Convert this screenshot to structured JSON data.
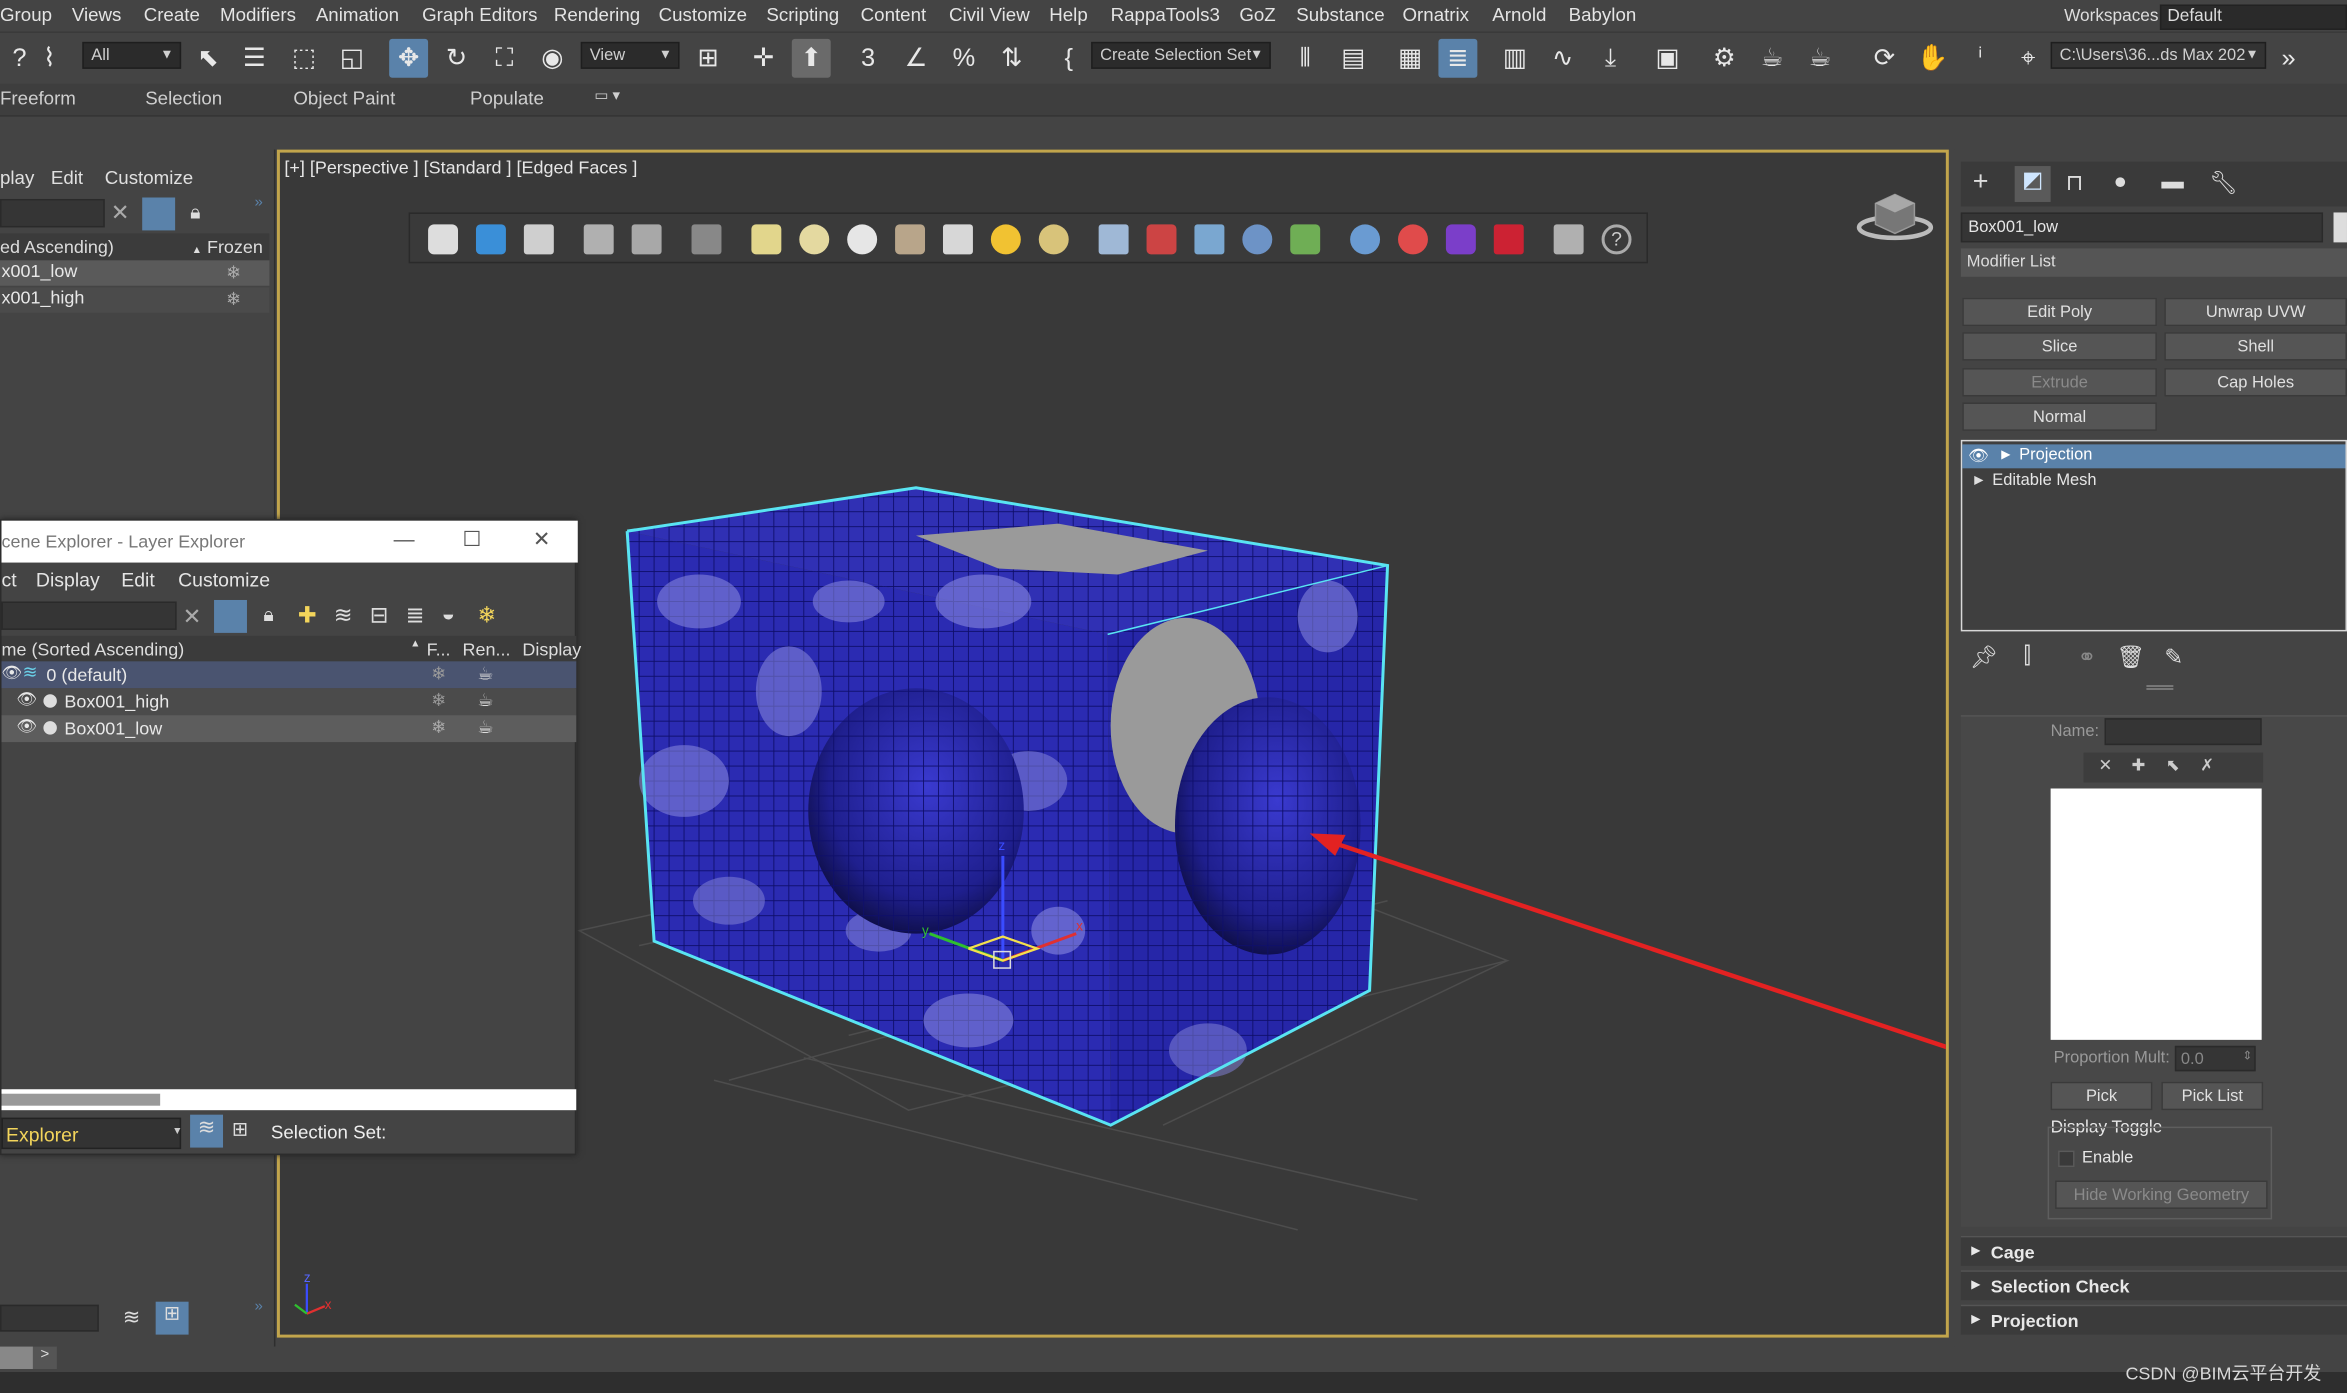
{
  "menubar": {
    "items": [
      "Group",
      "Views",
      "Create",
      "Modifiers",
      "Animation",
      "Graph Editors",
      "Rendering",
      "Customize",
      "Scripting",
      "Content",
      "Civil View",
      "Help",
      "RappaTools3",
      "GoZ",
      "Substance",
      "Ornatrix",
      "Arnold",
      "Babylon"
    ],
    "workspaces_label": "Workspaces:",
    "workspace_value": "Default"
  },
  "toolbar": {
    "filter_value": "All",
    "coord_value": "View",
    "selection_set_placeholder": "Create Selection Set",
    "project_path": "C:\\Users\\36...ds Max 202",
    "snap_label": "3"
  },
  "ribbon": {
    "tabs": [
      "Freeform",
      "Selection",
      "Object Paint",
      "Populate"
    ]
  },
  "left_explorer": {
    "menu": [
      "play",
      "Edit",
      "Customize"
    ],
    "column_name": "ed Ascending)",
    "column_frozen": "Frozen",
    "rows": [
      "x001_low",
      "x001_high"
    ]
  },
  "viewport": {
    "label": "[+] [Perspective ] [Standard ] [Edged Faces ]",
    "axis_labels": {
      "x": "x",
      "y": "y",
      "z": "z"
    }
  },
  "layer_explorer": {
    "title": "cene Explorer - Layer Explorer",
    "menu": [
      "ct",
      "Display",
      "Edit",
      "Customize"
    ],
    "columns": {
      "name": "me (Sorted Ascending)",
      "frozen": "F...",
      "render": "Ren...",
      "display": "Display"
    },
    "rows": [
      {
        "label": "0 (default)"
      },
      {
        "label": "Box001_high"
      },
      {
        "label": "Box001_low"
      }
    ],
    "footer_mode": "Explorer",
    "footer_selection": "Selection Set:"
  },
  "command_panel": {
    "object_name": "Box001_low",
    "modifier_list": "Modifier List",
    "buttons": [
      {
        "label": "Edit Poly",
        "disabled": false
      },
      {
        "label": "Unwrap UVW",
        "disabled": false
      },
      {
        "label": "Slice",
        "disabled": false
      },
      {
        "label": "Shell",
        "disabled": false
      },
      {
        "label": "Extrude",
        "disabled": true
      },
      {
        "label": "Cap Holes",
        "disabled": false
      },
      {
        "label": "Normal",
        "disabled": false
      }
    ],
    "stack": [
      "Projection",
      "Editable Mesh"
    ],
    "name_label": "Name:",
    "proportion_label": "Proportion Mult:",
    "proportion_value": "0.0",
    "pick_label": "Pick",
    "pick_list_label": "Pick List",
    "display_toggle_label": "Display Toggle",
    "enable_label": "Enable",
    "hide_geometry_label": "Hide Working Geometry",
    "rollouts": [
      "Cage",
      "Selection Check",
      "Projection"
    ]
  },
  "watermark": "CSDN @BIM云平台开发",
  "colors": {
    "accent_blue": "#5a82aa",
    "mesh_blue": "#2a2aae",
    "selection_cyan": "#59e4f2",
    "arrow_red": "#e32222",
    "viewport_border": "#c2a54c"
  }
}
